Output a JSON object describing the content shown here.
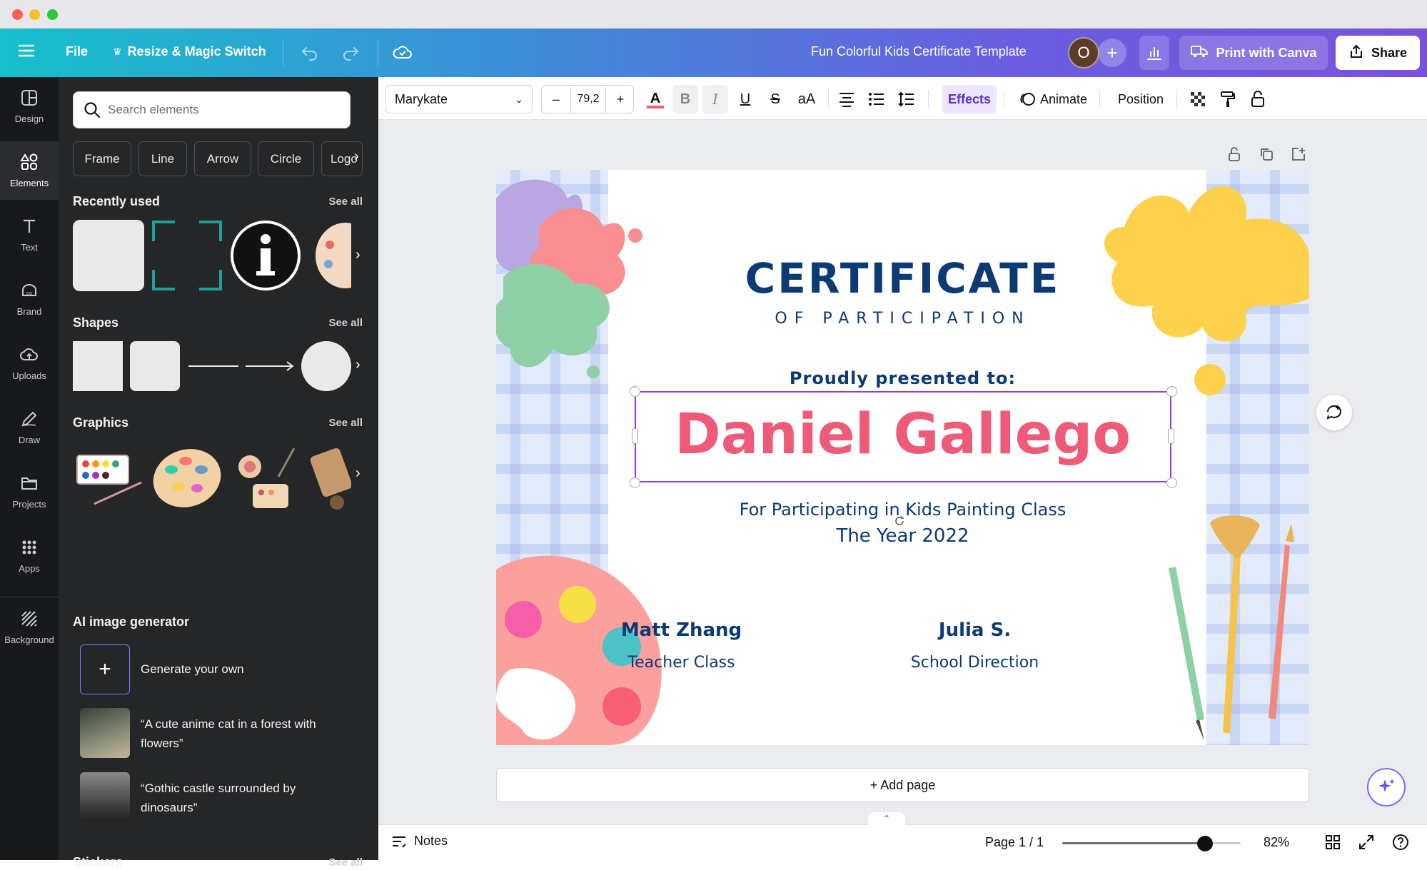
{
  "colors": {
    "accent": "#8b3dff",
    "navy": "#0b3a74",
    "pink": "#ef5a78"
  },
  "topbar": {
    "file": "File",
    "resize": "Resize & Magic Switch",
    "doc_title": "Fun Colorful Kids Certificate Template",
    "avatar": "O",
    "print": "Print with Canva",
    "share": "Share"
  },
  "rail": [
    {
      "label": "Design",
      "icon": "design-icon"
    },
    {
      "label": "Elements",
      "icon": "elements-icon"
    },
    {
      "label": "Text",
      "icon": "text-icon"
    },
    {
      "label": "Brand",
      "icon": "brand-icon"
    },
    {
      "label": "Uploads",
      "icon": "cloud-upload-icon"
    },
    {
      "label": "Draw",
      "icon": "pen-icon"
    },
    {
      "label": "Projects",
      "icon": "folder-icon"
    },
    {
      "label": "Apps",
      "icon": "grid-icon"
    },
    {
      "label": "Background",
      "icon": "hatch-icon"
    }
  ],
  "panel": {
    "search_placeholder": "Search elements",
    "chips": [
      "Frame",
      "Line",
      "Arrow",
      "Circle",
      "Logo"
    ],
    "recently_used": "Recently used",
    "shapes": "Shapes",
    "graphics": "Graphics",
    "ai": "AI image generator",
    "generate": "Generate your own",
    "prompt1": "“A cute anime cat in a forest with flowers”",
    "prompt2": "“Gothic castle surrounded by dinosaurs”",
    "stickers": "Stickers",
    "see_all": "See all"
  },
  "toolbar": {
    "font": "Marykate",
    "size": "79,2",
    "minus": "–",
    "plus": "+",
    "effects": "Effects",
    "animate": "Animate",
    "position": "Position"
  },
  "certificate": {
    "title": "CERTIFICATE",
    "subtitle": "OF PARTICIPATION",
    "presented": "Proudly presented to:",
    "name": "Daniel Gallego",
    "line1": "For Participating in Kids Painting Class",
    "line2": "The Year 2022",
    "sig1_name": "Matt Zhang",
    "sig1_role": "Teacher Class",
    "sig2_name": "Julia S.",
    "sig2_role": "School Direction"
  },
  "workspace": {
    "add_page": "+ Add page"
  },
  "footer": {
    "notes": "Notes",
    "page": "Page 1 / 1",
    "zoom": "82%",
    "zoom_level_percent": 82
  }
}
